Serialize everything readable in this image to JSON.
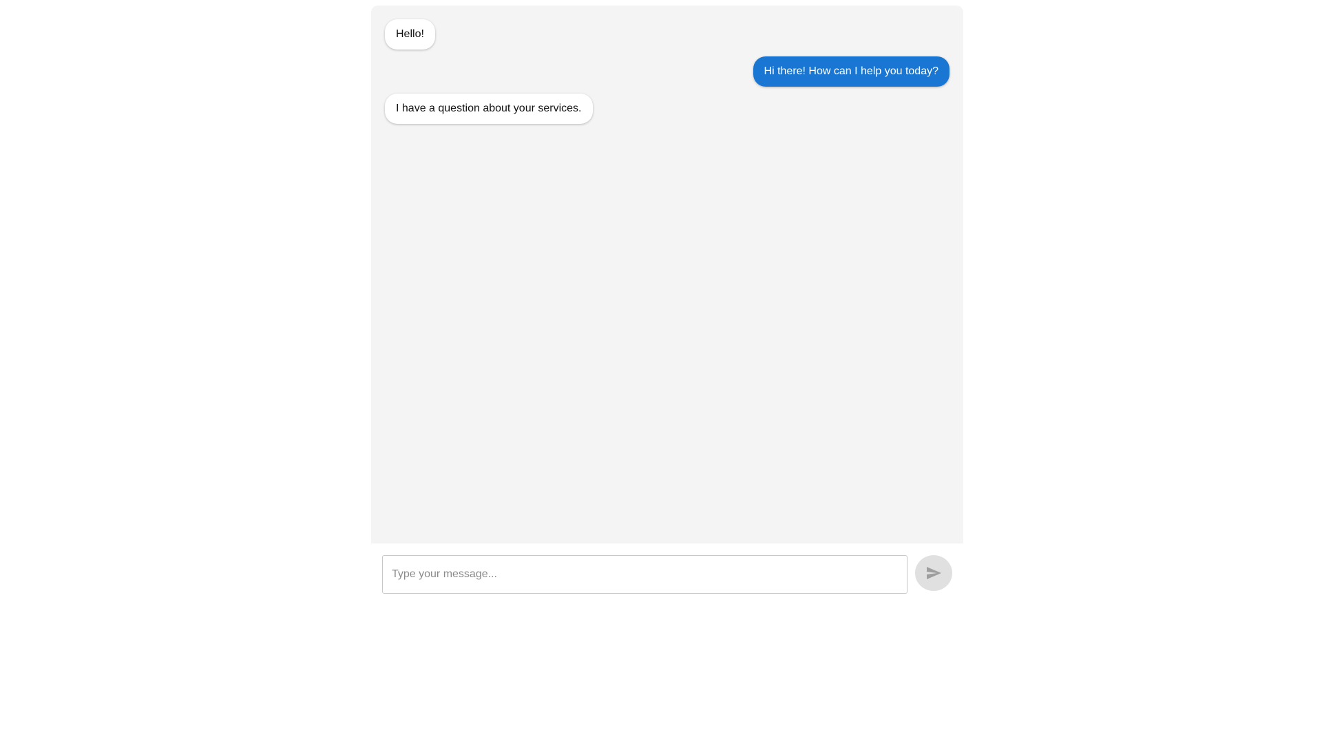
{
  "messages": [
    {
      "direction": "incoming",
      "text": "Hello!"
    },
    {
      "direction": "outgoing",
      "text": "Hi there! How can I help you today?"
    },
    {
      "direction": "incoming",
      "text": "I have a question about your services."
    }
  ],
  "composer": {
    "placeholder": "Type your message...",
    "value": "",
    "send_icon": "send-icon"
  },
  "colors": {
    "panel_background": "#f4f4f4",
    "outgoing_bubble": "#1976d2",
    "incoming_bubble": "#ffffff",
    "send_button_background": "#e0e0e0",
    "send_icon": "#9e9e9e"
  }
}
